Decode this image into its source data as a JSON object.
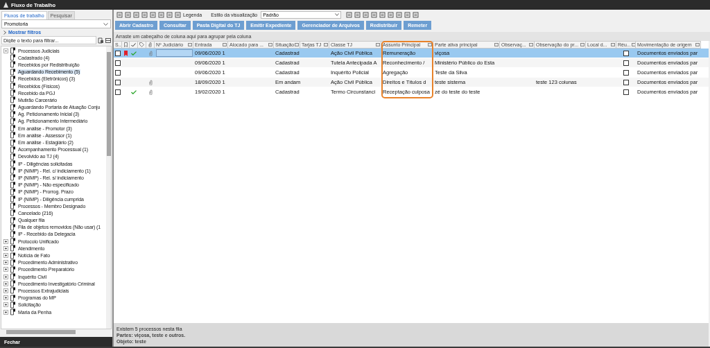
{
  "window": {
    "title": "Fluxo de Trabalho"
  },
  "sidebar": {
    "tabs": [
      {
        "label": "Fluxos de trabalho",
        "selected": true
      },
      {
        "label": "Pesquisar",
        "selected": false
      }
    ],
    "dropdown": "Promotoria",
    "filters_toggle": "Mostrar filtros",
    "filter": {
      "placeholder": "Digite o texto para filtrar..."
    },
    "tree": [
      {
        "label": "Processos Judiciais",
        "expanded": true,
        "selected": false,
        "children": [
          {
            "label": "Cadastrado (4)",
            "selected": false
          },
          {
            "label": "Recebidos por Redistribuição",
            "selected": false
          },
          {
            "label": "Aguardando Recebimento (5)",
            "selected": true
          },
          {
            "label": "Recebidos (Eletrônicos) (3)",
            "selected": false
          },
          {
            "label": "Recebidos (Físicos)",
            "selected": false
          },
          {
            "label": "Recebido da PGJ",
            "selected": false
          },
          {
            "label": "Mutirão Carcerário",
            "selected": false
          },
          {
            "label": "Aguardando Portaria de Atuação Conju",
            "selected": false
          },
          {
            "label": "Ag. Peticionamento Inicial (3)",
            "selected": false
          },
          {
            "label": "Ag. Peticionamento Intermediário",
            "selected": false
          },
          {
            "label": "Em análise - Promotor (3)",
            "selected": false
          },
          {
            "label": "Em análise - Assessor (1)",
            "selected": false
          },
          {
            "label": "Em análise - Estagiário (2)",
            "selected": false
          },
          {
            "label": "Acompanhamento Processual (1)",
            "selected": false
          },
          {
            "label": "Devolvido ao TJ (4)",
            "selected": false
          },
          {
            "label": "IP - Diligências solicitadas",
            "selected": false
          },
          {
            "label": "IP (NIMP) - Rel. c/ indiciamento (1)",
            "selected": false
          },
          {
            "label": "IP (NIMP) - Rel. s/ indiciamento",
            "selected": false
          },
          {
            "label": "IP (NIMP) - Não especificado",
            "selected": false
          },
          {
            "label": "IP (NIMP) - Prorrog. Prazo",
            "selected": false
          },
          {
            "label": "IP (NIMP) - Diligência cumprida",
            "selected": false
          },
          {
            "label": "Processos - Membro Designado",
            "selected": false
          },
          {
            "label": "Cancelado (216)",
            "selected": false
          },
          {
            "label": "Qualquer fila",
            "selected": false
          },
          {
            "label": "Fila de objetos removidos (Não usar) (1",
            "selected": false
          },
          {
            "label": "IP - Recebido da Delegacia",
            "selected": false
          }
        ]
      },
      {
        "label": "Protocolo Unificado",
        "expanded": false,
        "selected": false
      },
      {
        "label": "Atendimento",
        "expanded": false,
        "selected": false
      },
      {
        "label": "Notícia de Fato",
        "expanded": false,
        "selected": false
      },
      {
        "label": "Procedimento Administrativo",
        "expanded": false,
        "selected": false
      },
      {
        "label": "Procedimento Preparatório",
        "expanded": false,
        "selected": false
      },
      {
        "label": "Inquérito Civil",
        "expanded": false,
        "selected": false
      },
      {
        "label": "Procedimento Investigatório Criminal",
        "expanded": false,
        "selected": false
      },
      {
        "label": "Processos Extrajudiciais",
        "expanded": false,
        "selected": false
      },
      {
        "label": "Programas do MP",
        "expanded": false,
        "selected": false
      },
      {
        "label": "Solicitação",
        "expanded": false,
        "selected": false
      },
      {
        "label": "Maria da Penha",
        "expanded": false,
        "selected": false
      }
    ],
    "close_button": "Fechar"
  },
  "toolbar": {
    "legend": "Legenda",
    "view_style_label": "Estilo da visualização",
    "view_style": "Padrão"
  },
  "actions": [
    "Abrir Cadastro",
    "Consultar",
    "Pasta Digital do TJ",
    "Emitir Expediente",
    "Gerenciador de Arquivos",
    "Redistribuir",
    "Remeter"
  ],
  "group_hint": "Arraste um cabeçalho de coluna aqui para agrupar pela coluna",
  "table": {
    "columns": [
      {
        "kind": "select",
        "label": "S...",
        "highlighted": false
      },
      {
        "kind": "flag",
        "highlighted": false
      },
      {
        "kind": "done",
        "highlighted": false
      },
      {
        "kind": "icon",
        "highlighted": false
      },
      {
        "kind": "clip",
        "highlighted": false
      },
      {
        "kind": "text",
        "label": "Nº Judiciário",
        "highlighted": false
      },
      {
        "kind": "text",
        "label": "Entrada",
        "highlighted": false
      },
      {
        "kind": "text",
        "label": "Alocado para ...",
        "highlighted": false
      },
      {
        "kind": "text",
        "label": "Situação",
        "highlighted": false
      },
      {
        "kind": "text",
        "label": "Tarjas TJ",
        "highlighted": false
      },
      {
        "kind": "text",
        "label": "Classe TJ",
        "highlighted": false
      },
      {
        "kind": "text",
        "label": "Assunto Principal",
        "highlighted": true
      },
      {
        "kind": "text",
        "label": "Parte ativa principal",
        "highlighted": false
      },
      {
        "kind": "text",
        "label": "Observaç...",
        "highlighted": false
      },
      {
        "kind": "text",
        "label": "Observação do pr...",
        "highlighted": false
      },
      {
        "kind": "text",
        "label": "Local d...",
        "highlighted": false
      },
      {
        "kind": "reu",
        "label": "Réu...",
        "highlighted": false
      },
      {
        "kind": "text",
        "label": "Movimentação de origem",
        "highlighted": false
      }
    ],
    "rows": [
      {
        "selected": true,
        "checked": false,
        "flagged": true,
        "done": true,
        "attached": true,
        "reu": false,
        "cells": [
          "",
          "",
          "",
          "",
          "",
          "",
          "09/06/2020 1",
          "",
          "Cadastrad",
          "",
          "Ação Civil Pública",
          "Remuneração",
          "viçosa",
          "",
          "",
          "",
          "",
          "Documentos enviados par"
        ]
      },
      {
        "selected": false,
        "checked": false,
        "flagged": false,
        "done": false,
        "attached": false,
        "reu": false,
        "cells": [
          "",
          "",
          "",
          "",
          "",
          "",
          "09/06/2020 1",
          "",
          "Cadastrad",
          "",
          "Tutela Antecipada A",
          "Reconhecimento /",
          "Ministério Público do Esta",
          "",
          "",
          "",
          "",
          "Documentos enviados par"
        ]
      },
      {
        "selected": false,
        "checked": false,
        "flagged": false,
        "done": false,
        "attached": false,
        "reu": false,
        "cells": [
          "",
          "",
          "",
          "",
          "",
          "",
          "09/06/2020 1",
          "",
          "Cadastrad",
          "",
          "Inquérito Policial",
          "Agregação",
          "Teste da Silva",
          "",
          "",
          "",
          "",
          "Documentos enviados par"
        ]
      },
      {
        "selected": false,
        "checked": false,
        "flagged": false,
        "done": false,
        "attached": true,
        "reu": false,
        "cells": [
          "",
          "",
          "",
          "",
          "",
          "",
          "18/09/2020 1",
          "",
          "Em andam",
          "",
          "Ação Civil Pública",
          "Direitos e Títulos d",
          "teste sistema",
          "",
          "teste 123  colunas",
          "",
          "",
          "Documentos enviados par"
        ]
      },
      {
        "selected": false,
        "checked": false,
        "flagged": false,
        "done": true,
        "attached": true,
        "reu": false,
        "cells": [
          "",
          "",
          "",
          "",
          "",
          "",
          "19/02/2020 1",
          "",
          "Cadastrad",
          "",
          "Termo Circunstanci",
          "Receptação culposa",
          "zé do teste do teste",
          "",
          "",
          "",
          "",
          "Documentos enviados par"
        ]
      }
    ]
  },
  "status": {
    "count": "Existem 5 processos nesta fila",
    "parties": "Partes: viçosa, teste e outros.",
    "object": "Objeto: teste"
  }
}
